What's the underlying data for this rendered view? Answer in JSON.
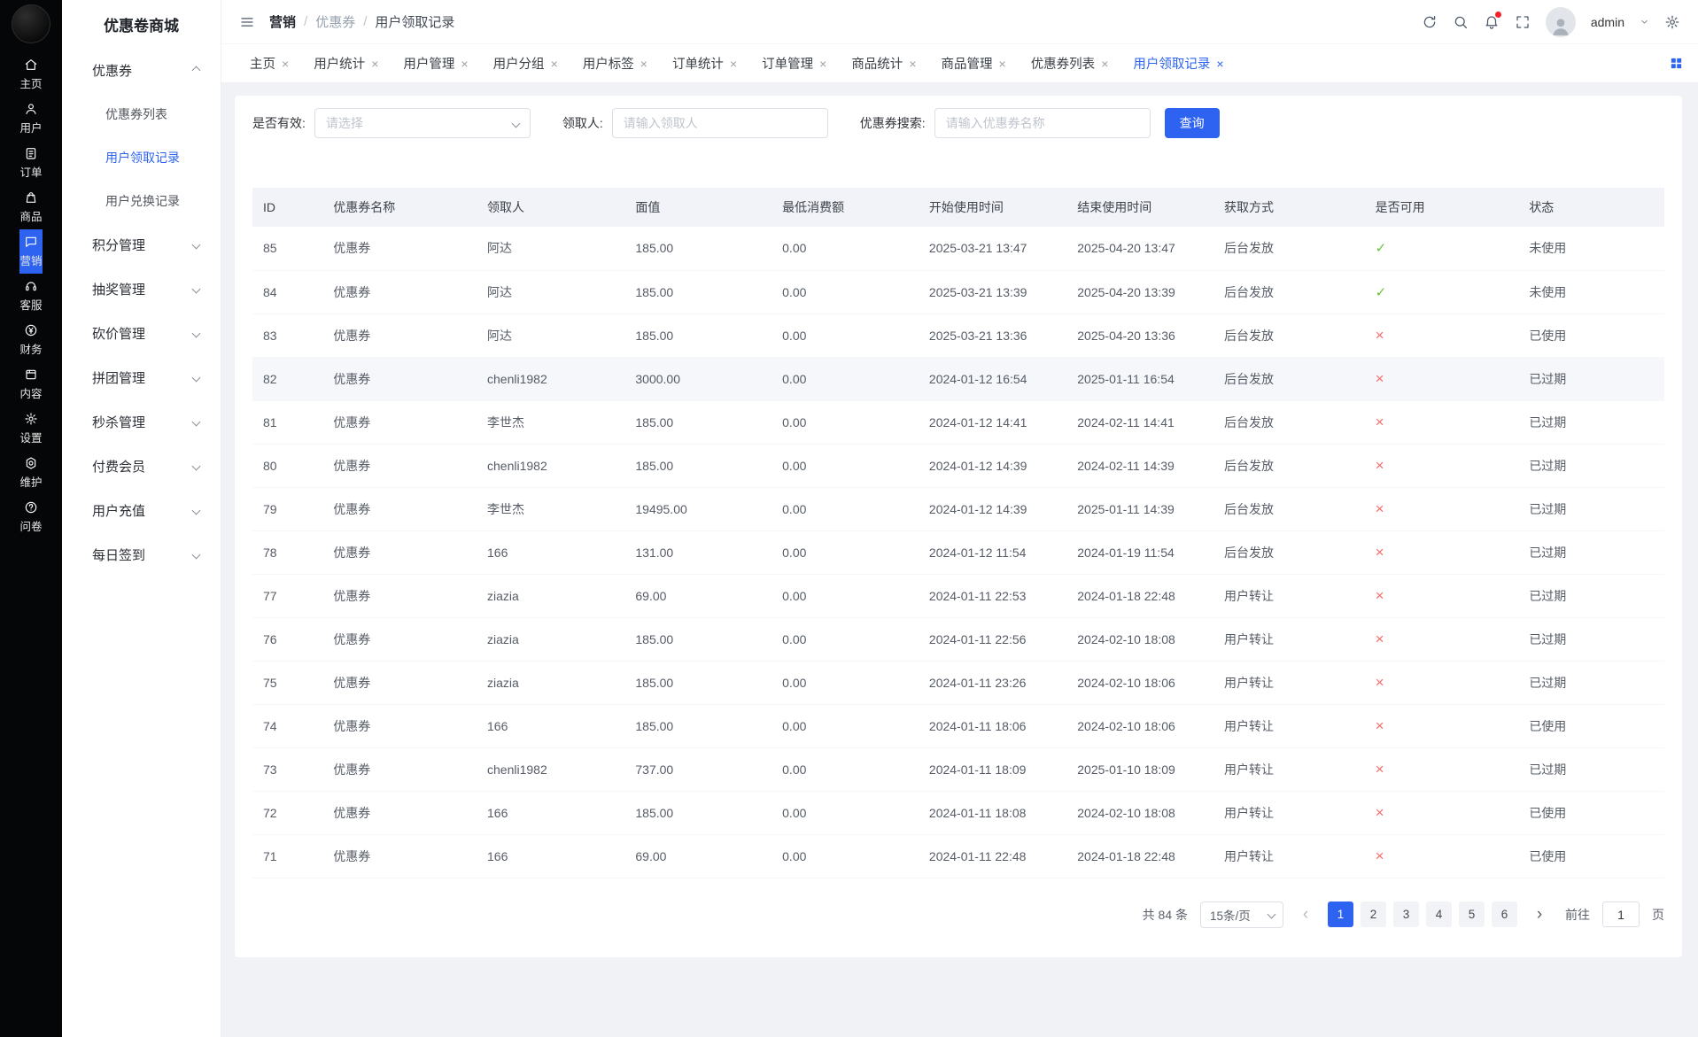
{
  "colors": {
    "accent": "#2d63f0",
    "danger": "#f56c6c",
    "success": "#67c23a"
  },
  "rail": {
    "items": [
      {
        "label": "主页",
        "icon": "home-icon",
        "active": false
      },
      {
        "label": "用户",
        "icon": "user-icon",
        "active": false
      },
      {
        "label": "订单",
        "icon": "order-icon",
        "active": false
      },
      {
        "label": "商品",
        "icon": "goods-icon",
        "active": false
      },
      {
        "label": "营销",
        "icon": "marketing-icon",
        "active": true
      },
      {
        "label": "客服",
        "icon": "service-icon",
        "active": false
      },
      {
        "label": "财务",
        "icon": "finance-icon",
        "active": false
      },
      {
        "label": "内容",
        "icon": "content-icon",
        "active": false
      },
      {
        "label": "设置",
        "icon": "settings-icon",
        "active": false
      },
      {
        "label": "维护",
        "icon": "maintenance-icon",
        "active": false
      },
      {
        "label": "问卷",
        "icon": "survey-icon",
        "active": false
      }
    ]
  },
  "submenu": {
    "title": "优惠卷商城",
    "groups": [
      {
        "label": "优惠券",
        "expanded": true,
        "children": [
          {
            "label": "优惠券列表",
            "active": false
          },
          {
            "label": "用户领取记录",
            "active": true
          },
          {
            "label": "用户兑换记录",
            "active": false
          }
        ]
      },
      {
        "label": "积分管理",
        "expanded": false,
        "children": []
      },
      {
        "label": "抽奖管理",
        "expanded": false,
        "children": []
      },
      {
        "label": "砍价管理",
        "expanded": false,
        "children": []
      },
      {
        "label": "拼团管理",
        "expanded": false,
        "children": []
      },
      {
        "label": "秒杀管理",
        "expanded": false,
        "children": []
      },
      {
        "label": "付费会员",
        "expanded": false,
        "children": []
      },
      {
        "label": "用户充值",
        "expanded": false,
        "children": []
      },
      {
        "label": "每日签到",
        "expanded": false,
        "children": []
      }
    ]
  },
  "header": {
    "breadcrumb": [
      {
        "label": "营销",
        "muted": false
      },
      {
        "label": "优惠券",
        "muted": true
      },
      {
        "label": "用户领取记录",
        "muted": false
      }
    ],
    "username": "admin"
  },
  "tabs": [
    {
      "label": "主页",
      "active": false
    },
    {
      "label": "用户统计",
      "active": false
    },
    {
      "label": "用户管理",
      "active": false
    },
    {
      "label": "用户分组",
      "active": false
    },
    {
      "label": "用户标签",
      "active": false
    },
    {
      "label": "订单统计",
      "active": false
    },
    {
      "label": "订单管理",
      "active": false
    },
    {
      "label": "商品统计",
      "active": false
    },
    {
      "label": "商品管理",
      "active": false
    },
    {
      "label": "优惠券列表",
      "active": false
    },
    {
      "label": "用户领取记录",
      "active": true
    }
  ],
  "filters": {
    "valid_label": "是否有效:",
    "valid_placeholder": "请选择",
    "receiver_label": "领取人:",
    "receiver_placeholder": "请输入领取人",
    "coupon_label": "优惠券搜索:",
    "coupon_placeholder": "请输入优惠券名称",
    "search_button": "查询"
  },
  "table": {
    "columns": [
      "ID",
      "优惠券名称",
      "领取人",
      "面值",
      "最低消费额",
      "开始使用时间",
      "结束使用时间",
      "获取方式",
      "是否可用",
      "状态"
    ],
    "rows": [
      {
        "id": "85",
        "coupon": "优惠券",
        "receiver": "阿达",
        "value": "185.00",
        "min_spend": "0.00",
        "start": "2025-03-21 13:47",
        "end": "2025-04-20 13:47",
        "method": "后台发放",
        "usable": true,
        "status": "未使用",
        "highlight": false
      },
      {
        "id": "84",
        "coupon": "优惠券",
        "receiver": "阿达",
        "value": "185.00",
        "min_spend": "0.00",
        "start": "2025-03-21 13:39",
        "end": "2025-04-20 13:39",
        "method": "后台发放",
        "usable": true,
        "status": "未使用",
        "highlight": false
      },
      {
        "id": "83",
        "coupon": "优惠券",
        "receiver": "阿达",
        "value": "185.00",
        "min_spend": "0.00",
        "start": "2025-03-21 13:36",
        "end": "2025-04-20 13:36",
        "method": "后台发放",
        "usable": false,
        "status": "已使用",
        "highlight": false
      },
      {
        "id": "82",
        "coupon": "优惠券",
        "receiver": "chenli1982",
        "value": "3000.00",
        "min_spend": "0.00",
        "start": "2024-01-12 16:54",
        "end": "2025-01-11 16:54",
        "method": "后台发放",
        "usable": false,
        "status": "已过期",
        "highlight": true
      },
      {
        "id": "81",
        "coupon": "优惠券",
        "receiver": "李世杰",
        "value": "185.00",
        "min_spend": "0.00",
        "start": "2024-01-12 14:41",
        "end": "2024-02-11 14:41",
        "method": "后台发放",
        "usable": false,
        "status": "已过期",
        "highlight": false
      },
      {
        "id": "80",
        "coupon": "优惠券",
        "receiver": "chenli1982",
        "value": "185.00",
        "min_spend": "0.00",
        "start": "2024-01-12 14:39",
        "end": "2024-02-11 14:39",
        "method": "后台发放",
        "usable": false,
        "status": "已过期",
        "highlight": false
      },
      {
        "id": "79",
        "coupon": "优惠券",
        "receiver": "李世杰",
        "value": "19495.00",
        "min_spend": "0.00",
        "start": "2024-01-12 14:39",
        "end": "2025-01-11 14:39",
        "method": "后台发放",
        "usable": false,
        "status": "已过期",
        "highlight": false
      },
      {
        "id": "78",
        "coupon": "优惠券",
        "receiver": "166",
        "value": "131.00",
        "min_spend": "0.00",
        "start": "2024-01-12 11:54",
        "end": "2024-01-19 11:54",
        "method": "后台发放",
        "usable": false,
        "status": "已过期",
        "highlight": false
      },
      {
        "id": "77",
        "coupon": "优惠券",
        "receiver": "ziazia",
        "value": "69.00",
        "min_spend": "0.00",
        "start": "2024-01-11 22:53",
        "end": "2024-01-18 22:48",
        "method": "用户转让",
        "usable": false,
        "status": "已过期",
        "highlight": false
      },
      {
        "id": "76",
        "coupon": "优惠券",
        "receiver": "ziazia",
        "value": "185.00",
        "min_spend": "0.00",
        "start": "2024-01-11 22:56",
        "end": "2024-02-10 18:08",
        "method": "用户转让",
        "usable": false,
        "status": "已过期",
        "highlight": false
      },
      {
        "id": "75",
        "coupon": "优惠券",
        "receiver": "ziazia",
        "value": "185.00",
        "min_spend": "0.00",
        "start": "2024-01-11 23:26",
        "end": "2024-02-10 18:06",
        "method": "用户转让",
        "usable": false,
        "status": "已过期",
        "highlight": false
      },
      {
        "id": "74",
        "coupon": "优惠券",
        "receiver": "166",
        "value": "185.00",
        "min_spend": "0.00",
        "start": "2024-01-11 18:06",
        "end": "2024-02-10 18:06",
        "method": "用户转让",
        "usable": false,
        "status": "已使用",
        "highlight": false
      },
      {
        "id": "73",
        "coupon": "优惠券",
        "receiver": "chenli1982",
        "value": "737.00",
        "min_spend": "0.00",
        "start": "2024-01-11 18:09",
        "end": "2025-01-10 18:09",
        "method": "用户转让",
        "usable": false,
        "status": "已过期",
        "highlight": false
      },
      {
        "id": "72",
        "coupon": "优惠券",
        "receiver": "166",
        "value": "185.00",
        "min_spend": "0.00",
        "start": "2024-01-11 18:08",
        "end": "2024-02-10 18:08",
        "method": "用户转让",
        "usable": false,
        "status": "已使用",
        "highlight": false
      },
      {
        "id": "71",
        "coupon": "优惠券",
        "receiver": "166",
        "value": "69.00",
        "min_spend": "0.00",
        "start": "2024-01-11 22:48",
        "end": "2024-01-18 22:48",
        "method": "用户转让",
        "usable": false,
        "status": "已使用",
        "highlight": false
      }
    ]
  },
  "pagination": {
    "total": "共 84 条",
    "page_size": "15条/页",
    "pages": [
      "1",
      "2",
      "3",
      "4",
      "5",
      "6"
    ],
    "active_page": "1",
    "prev": "‹",
    "next": "›",
    "goto_label": "前往",
    "goto_value": "1",
    "goto_suffix": "页"
  }
}
